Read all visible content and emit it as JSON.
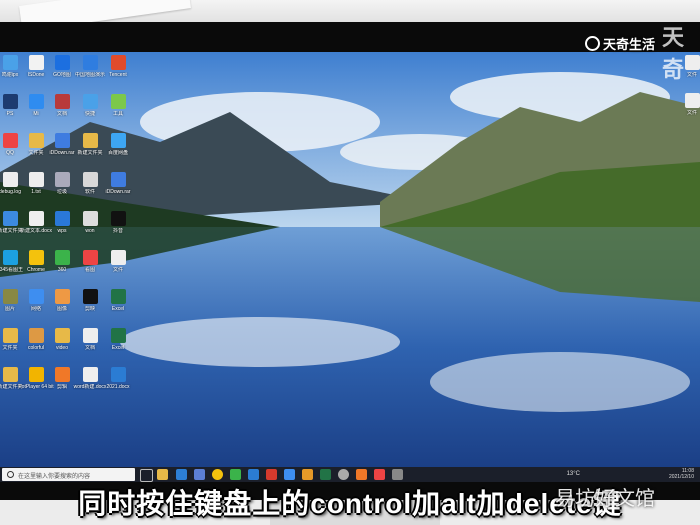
{
  "desktop": {
    "icons": [
      {
        "label": "鸣谢ipx",
        "color": "#4aa1e8"
      },
      {
        "label": "ISDone",
        "color": "#f2f2f2"
      },
      {
        "label": "GO地图",
        "color": "#1c6fe0"
      },
      {
        "label": "中国地图演示",
        "color": "#2f7de0"
      },
      {
        "label": "Tencent",
        "color": "#e04b2b"
      },
      {
        "label": "PS",
        "color": "#1d3b70"
      },
      {
        "label": "Mi",
        "color": "#2f8cf0"
      },
      {
        "label": "文档",
        "color": "#b83a3a"
      },
      {
        "label": "快捷",
        "color": "#4aa1e8"
      },
      {
        "label": "工具",
        "color": "#7cc84a"
      },
      {
        "label": "QQ",
        "color": "#e44"
      },
      {
        "label": "文件夹",
        "color": "#e7b948"
      },
      {
        "label": "iDDown.rar",
        "color": "#3f7ce0"
      },
      {
        "label": "新建文件夹",
        "color": "#e7b948"
      },
      {
        "label": "百度网盘",
        "color": "#3da6f3"
      },
      {
        "label": "debug.log",
        "color": "#eee"
      },
      {
        "label": "1.txt",
        "color": "#eee"
      },
      {
        "label": "垃圾",
        "color": "#aab"
      },
      {
        "label": "软件",
        "color": "#d8d8d8"
      },
      {
        "label": "iDDown.rar",
        "color": "#3f7ce0"
      },
      {
        "label": "新建文件夹",
        "color": "#3c8ae0"
      },
      {
        "label": "新建文本.docx",
        "color": "#eee"
      },
      {
        "label": "wps",
        "color": "#2a78d8"
      },
      {
        "label": "won",
        "color": "#ddd"
      },
      {
        "label": "抖音",
        "color": "#111"
      },
      {
        "label": "2345看图王",
        "color": "#1ca0e0"
      },
      {
        "label": "Chrome",
        "color": "#f4c20d"
      },
      {
        "label": "360",
        "color": "#3bb34a"
      },
      {
        "label": "看图",
        "color": "#e44"
      },
      {
        "label": "文件",
        "color": "#eee"
      },
      {
        "label": "图片",
        "color": "#884"
      },
      {
        "label": "网络",
        "color": "#3e8ef0"
      },
      {
        "label": "图像",
        "color": "#e94"
      },
      {
        "label": "剪映",
        "color": "#111"
      },
      {
        "label": "Excel",
        "color": "#217346"
      },
      {
        "label": "文件夹",
        "color": "#e7b948"
      },
      {
        "label": "colorful",
        "color": "#d94"
      },
      {
        "label": "video",
        "color": "#e7b948"
      },
      {
        "label": "文档",
        "color": "#eee"
      },
      {
        "label": "Excel",
        "color": "#217346"
      },
      {
        "label": "新建文件夹",
        "color": "#e7b948"
      },
      {
        "label": "PotPlayer 64 bit",
        "color": "#f2b400"
      },
      {
        "label": "剪辑",
        "color": "#f07828"
      },
      {
        "label": "word新建.docx",
        "color": "#eee"
      },
      {
        "label": "2021.docx",
        "color": "#2b7cd3"
      }
    ],
    "right_icons": [
      {
        "label": "文件",
        "color": "#eee"
      },
      {
        "label": "文件",
        "color": "#eee"
      }
    ]
  },
  "taskbar": {
    "search_placeholder": "在这里输入你要搜索的内容",
    "weather": "13°C",
    "time": "11:08",
    "date": "2021/12/10"
  },
  "overlay": {
    "logo": "天奇生活",
    "logo_big": "天奇",
    "subtitle": "同时按住键盘上的control加alt加delete键",
    "watermark": "易坊好文馆"
  }
}
